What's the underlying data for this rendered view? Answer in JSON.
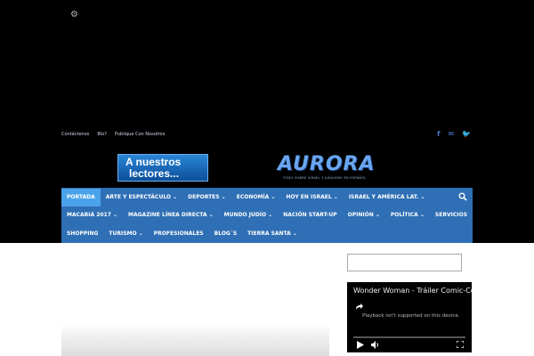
{
  "top_links": [
    "Contáctenos",
    "Bío?",
    "Publique Con Nosotros"
  ],
  "banner": {
    "line1": "A nuestros",
    "line2": "lectores..."
  },
  "logo": {
    "name": "AURORA",
    "tagline": "TODO SOBRE ISRAEL Y JUDAISMO EN ESPAÑOL"
  },
  "nav": {
    "row1": [
      "PORTADA",
      "ARTE Y ESPECTÁCULO ⌄",
      "DEPORTES ⌄",
      "ECONOMÍA ⌄",
      "HOY EN ISRAEL ⌄",
      "ISRAEL Y AMÉRICA LAT. ⌄"
    ],
    "row2": [
      "MACABIÁ 2017 ⌄",
      "MAGAZINE LÍNEA DIRECTA ⌄",
      "MUNDO JUDÍO ⌄",
      "NACIÓN START-UP",
      "OPINIÓN ⌄",
      "POLÍTICA ⌄",
      "SERVICIOS"
    ],
    "row3": [
      "SHOPPING",
      "TURISMO ⌄",
      "PROFESIONALES",
      "BLOG´S",
      "TIERRA SANTA ⌄"
    ]
  },
  "video": {
    "title": "Wonder Woman - Tráiler Comic-Con",
    "message": "Playback isn't supported on this device."
  },
  "colors": {
    "nav_bg": "#2f6fb5",
    "nav_active": "#4aa3ea",
    "social": "#4a78c8"
  },
  "icons": [
    "settings-icon",
    "facebook-icon",
    "email-icon",
    "twitter-icon",
    "search-icon",
    "share-icon",
    "play-icon",
    "volume-icon",
    "fullscreen-icon"
  ]
}
